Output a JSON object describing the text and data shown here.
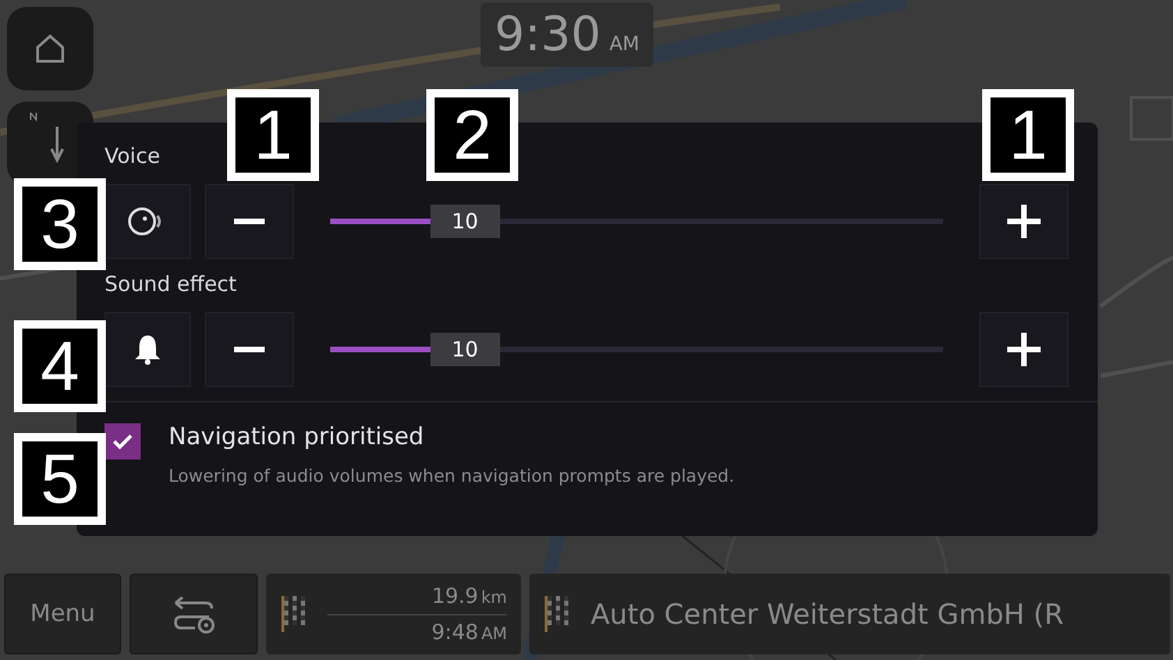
{
  "clock": {
    "time": "9:30",
    "period": "AM"
  },
  "sound_panel": {
    "volumes": [
      {
        "label": "Voice",
        "kind": "voice",
        "level": 0.22,
        "reading": "10"
      },
      {
        "label": "Sound effect",
        "kind": "effect",
        "level": 0.22,
        "reading": "10"
      }
    ],
    "option": {
      "title": "Navigation prioritised",
      "description": "Lowering of audio volumes when navigation prompts are played.",
      "checked": true
    }
  },
  "bottom_bar": {
    "menu": "Menu",
    "distance": "19.9",
    "distance_unit": "km",
    "arrival": "9:48",
    "arrival_period": "AM",
    "destination": "Auto Center Weiterstadt GmbH (R"
  },
  "callouts": [
    "1",
    "2",
    "1",
    "3",
    "4",
    "5"
  ]
}
